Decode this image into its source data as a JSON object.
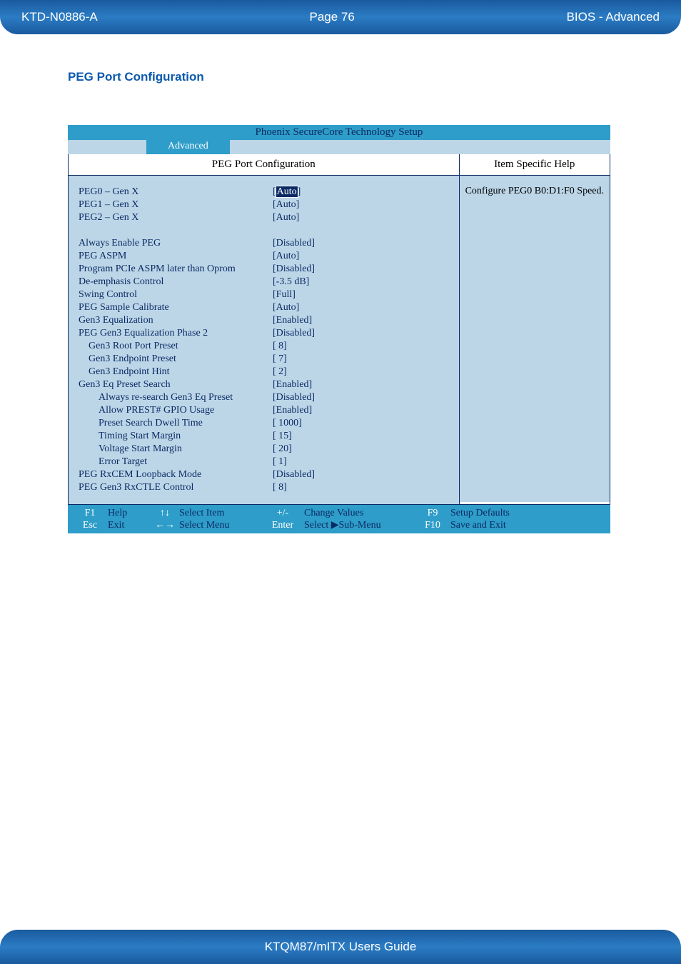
{
  "header": {
    "doc_id": "KTD-N0886-A",
    "page": "Page 76",
    "section": "BIOS  - Advanced"
  },
  "heading": "PEG Port Configuration",
  "bios": {
    "title": "Phoenix SecureCore Technology Setup",
    "tab": "Advanced",
    "left_header": "PEG Port Configuration",
    "right_header": "Item Specific Help",
    "help_text": "Configure PEG0 B0:D1:F0 Speed.",
    "rows": [
      {
        "label": "PEG0 – Gen X",
        "value": "[Auto]",
        "highlight": true,
        "indent": 0
      },
      {
        "label": "PEG1 – Gen X",
        "value": "[Auto]",
        "indent": 0
      },
      {
        "label": "PEG2 – Gen X",
        "value": "[Auto]",
        "indent": 0
      },
      {
        "spacer": true
      },
      {
        "label": "Always Enable PEG",
        "value": "[Disabled]",
        "indent": 0
      },
      {
        "label": "PEG ASPM",
        "value": "[Auto]",
        "indent": 0
      },
      {
        "label": "Program PCIe ASPM later than Oprom",
        "value": "[Disabled]",
        "indent": 0
      },
      {
        "label": "De-emphasis Control",
        "value": "[-3.5 dB]",
        "indent": 0
      },
      {
        "label": "Swing Control",
        "value": "[Full]",
        "indent": 0
      },
      {
        "label": "PEG Sample Calibrate",
        "value": "[Auto]",
        "indent": 0
      },
      {
        "label": "Gen3 Equalization",
        "value": "[Enabled]",
        "indent": 0
      },
      {
        "label": "PEG Gen3 Equalization Phase 2",
        "value": "[Disabled]",
        "indent": 0
      },
      {
        "label": "Gen3 Root Port Preset",
        "value": "[  8]",
        "indent": 1
      },
      {
        "label": "Gen3 Endpoint Preset",
        "value": "[  7]",
        "indent": 1
      },
      {
        "label": "Gen3 Endpoint Hint",
        "value": "[  2]",
        "indent": 1
      },
      {
        "label": "Gen3 Eq Preset Search",
        "value": "[Enabled]",
        "indent": 0
      },
      {
        "label": "Always re-search Gen3 Eq Preset",
        "value": "[Disabled]",
        "indent": 2
      },
      {
        "label": "Allow PREST# GPIO Usage",
        "value": "[Enabled]",
        "indent": 2
      },
      {
        "label": "Preset Search Dwell Time",
        "value": "[ 1000]",
        "indent": 2
      },
      {
        "label": "Timing Start Margin",
        "value": "[ 15]",
        "indent": 2
      },
      {
        "label": "Voltage Start Margin",
        "value": "[ 20]",
        "indent": 2
      },
      {
        "label": "Error Target",
        "value": "[      1]",
        "indent": 2
      },
      {
        "label": "PEG RxCEM Loopback Mode",
        "value": "[Disabled]",
        "indent": 0
      },
      {
        "label": "PEG Gen3 RxCTLE Control",
        "value": "[   8]",
        "indent": 0
      }
    ],
    "footer": {
      "r1": {
        "k1": "F1",
        "a1": "Help",
        "k2": "↑↓",
        "a2": "Select Item",
        "k3": "+/-",
        "a3": "Change Values",
        "k4": "F9",
        "a4": "Setup Defaults"
      },
      "r2": {
        "k1": "Esc",
        "a1": "Exit",
        "k2": "←→",
        "a2": "Select Menu",
        "k3": "Enter",
        "a3": "Select ▶Sub-Menu",
        "k4": "F10",
        "a4": "Save and Exit"
      }
    }
  },
  "footer_title": "KTQM87/mITX Users Guide"
}
